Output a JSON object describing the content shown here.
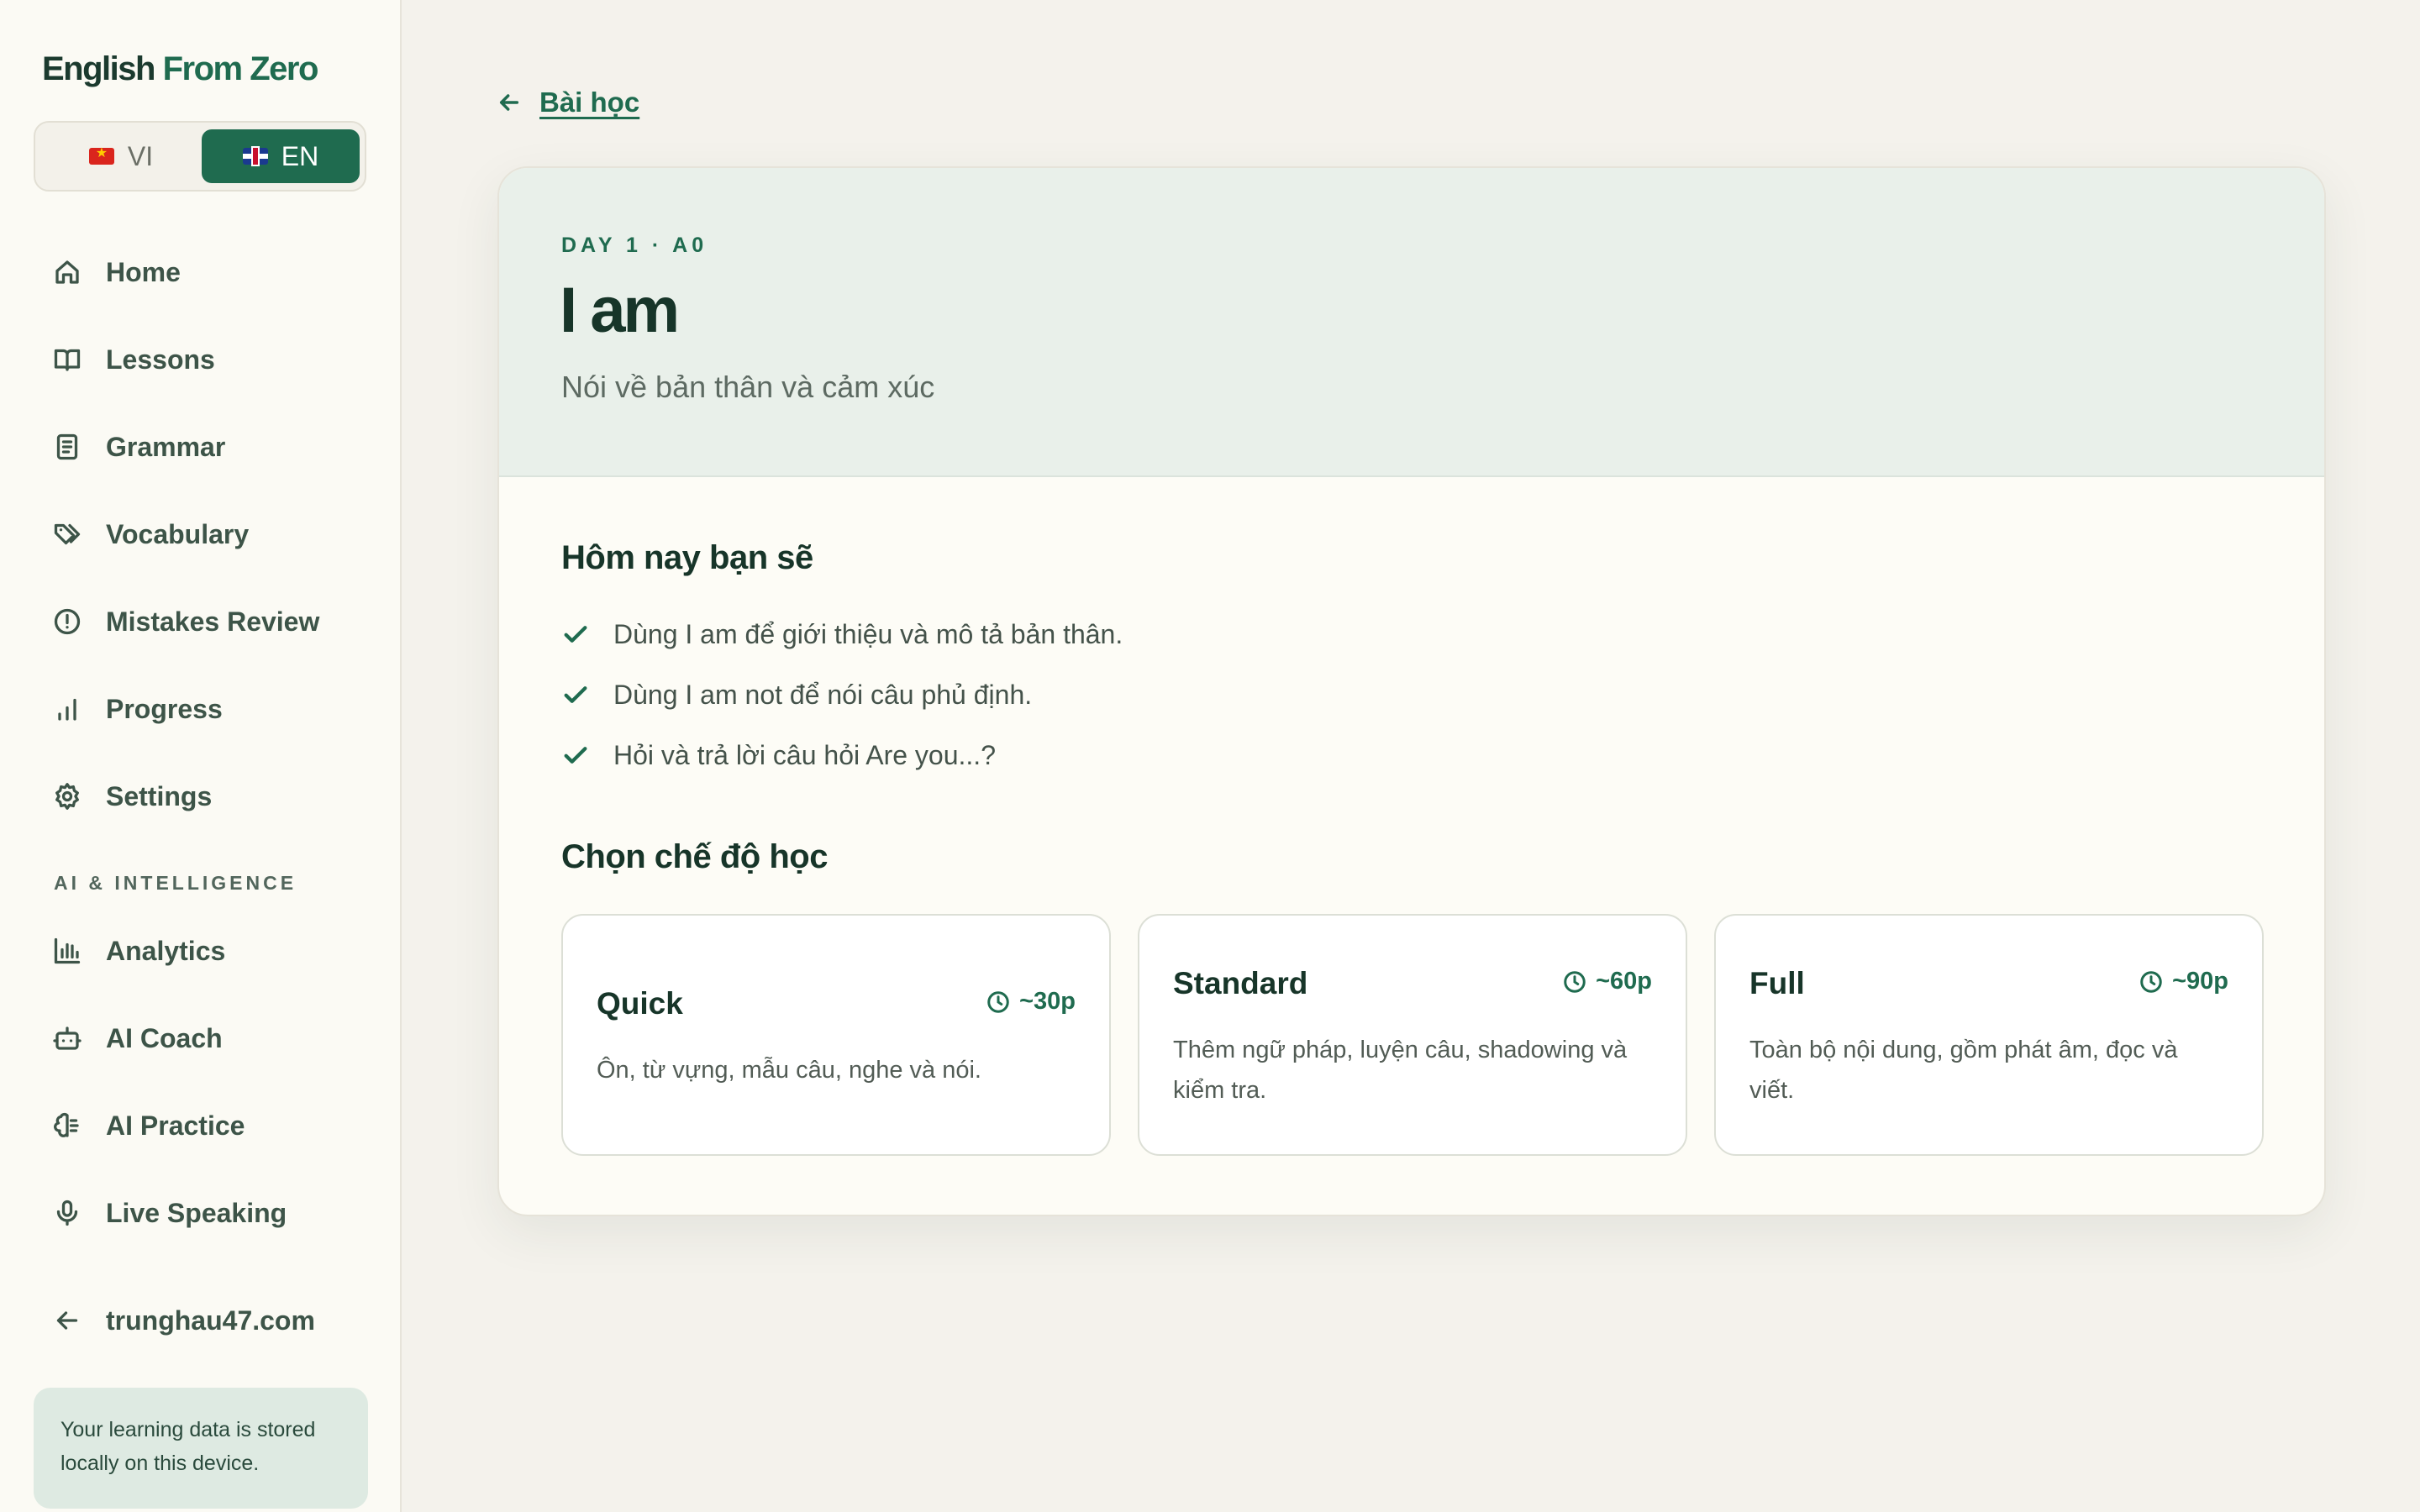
{
  "brand": {
    "name_part1": "English",
    "name_part2": "From Zero"
  },
  "language_switch": {
    "vi_label": "VI",
    "en_label": "EN",
    "selected": "EN"
  },
  "nav": {
    "items": [
      {
        "label": "Home",
        "icon": "home-icon"
      },
      {
        "label": "Lessons",
        "icon": "book-open-icon"
      },
      {
        "label": "Grammar",
        "icon": "notebook-icon"
      },
      {
        "label": "Vocabulary",
        "icon": "tags-icon"
      },
      {
        "label": "Mistakes Review",
        "icon": "alert-circle-icon"
      },
      {
        "label": "Progress",
        "icon": "bar-chart-icon"
      },
      {
        "label": "Settings",
        "icon": "gear-icon"
      }
    ],
    "section_label": "AI & INTELLIGENCE",
    "ai_items": [
      {
        "label": "Analytics",
        "icon": "analytics-chart-icon"
      },
      {
        "label": "AI Coach",
        "icon": "bot-icon"
      },
      {
        "label": "AI Practice",
        "icon": "brain-icon"
      },
      {
        "label": "Live Speaking",
        "icon": "microphone-icon"
      }
    ],
    "external_link": "trunghau47.com",
    "storage_note": "Your learning data is stored locally on this device."
  },
  "back_link": {
    "label": "Bài học"
  },
  "lesson": {
    "eyebrow": "DAY 1 · A0",
    "title": "I am",
    "subtitle": "Nói về bản thân và cảm xúc"
  },
  "goals": {
    "title": "Hôm nay bạn sẽ",
    "items": [
      "Dùng I am để giới thiệu và mô tả bản thân.",
      "Dùng I am not để nói câu phủ định.",
      "Hỏi và trả lời câu hỏi Are you...?"
    ]
  },
  "modes": {
    "title": "Chọn chế độ học",
    "items": [
      {
        "name": "Quick",
        "time": "~30p",
        "description": "Ôn, từ vựng, mẫu câu, nghe và nói."
      },
      {
        "name": "Standard",
        "time": "~60p",
        "description": "Thêm ngữ pháp, luyện câu, shadowing và kiểm tra."
      },
      {
        "name": "Full",
        "time": "~90p",
        "description": "Toàn bộ nội dung, gồm phát âm, đọc và viết."
      }
    ]
  },
  "colors": {
    "accent": "#1f6b4f",
    "background": "#f4f2ec",
    "sidebar": "#fbfaf4",
    "card_header": "#e9f0ea"
  }
}
